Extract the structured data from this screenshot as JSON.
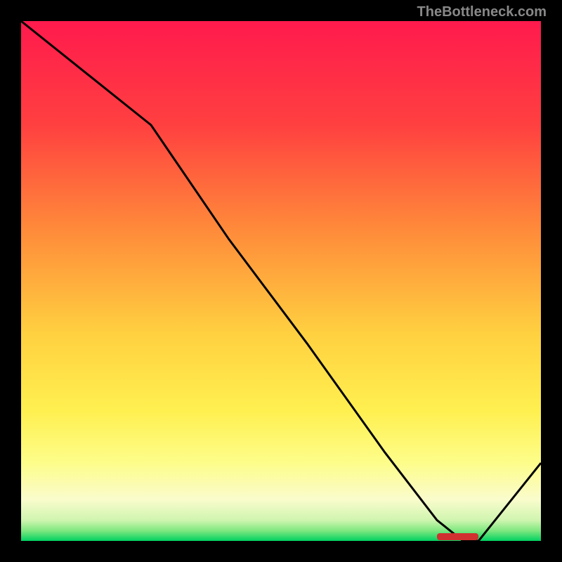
{
  "watermark": "TheBottleneck.com",
  "chart_data": {
    "type": "line",
    "title": "",
    "xlabel": "",
    "ylabel": "",
    "xlim": [
      0,
      100
    ],
    "ylim": [
      0,
      100
    ],
    "x": [
      0,
      10,
      25,
      40,
      55,
      70,
      80,
      85,
      88,
      100
    ],
    "values": [
      100,
      92,
      80,
      58,
      38,
      17,
      4,
      0,
      0,
      15
    ],
    "gradient_stops": [
      {
        "offset": 0,
        "color": "#ff1a4d"
      },
      {
        "offset": 20,
        "color": "#ff4040"
      },
      {
        "offset": 40,
        "color": "#ff8a3a"
      },
      {
        "offset": 60,
        "color": "#ffd040"
      },
      {
        "offset": 75,
        "color": "#fff050"
      },
      {
        "offset": 85,
        "color": "#fdfd8a"
      },
      {
        "offset": 92,
        "color": "#fafccc"
      },
      {
        "offset": 96,
        "color": "#d0f5b0"
      },
      {
        "offset": 98,
        "color": "#80e880"
      },
      {
        "offset": 100,
        "color": "#00d060"
      }
    ],
    "marker": {
      "x_start": 80,
      "x_end": 88,
      "color": "#d03030"
    }
  }
}
